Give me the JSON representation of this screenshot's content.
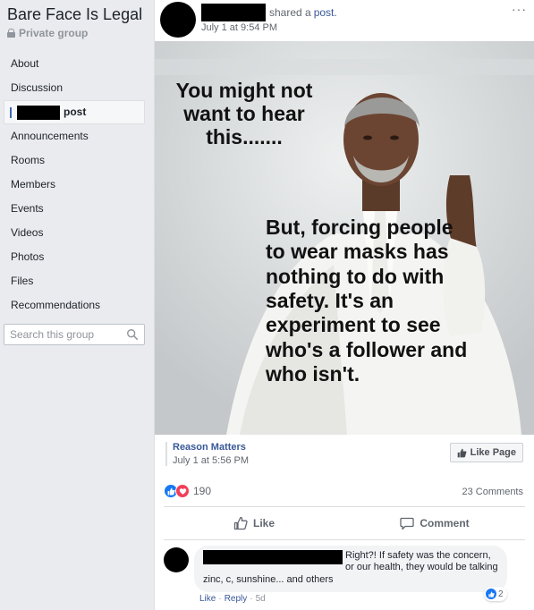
{
  "sidebar": {
    "group_name": "Bare Face Is Legal",
    "privacy": "Private group",
    "nav": [
      {
        "label": "About"
      },
      {
        "label": "Discussion"
      },
      {
        "label": "post",
        "active": true
      },
      {
        "label": "Announcements"
      },
      {
        "label": "Rooms"
      },
      {
        "label": "Members"
      },
      {
        "label": "Events"
      },
      {
        "label": "Videos"
      },
      {
        "label": "Photos"
      },
      {
        "label": "Files"
      },
      {
        "label": "Recommendations"
      }
    ],
    "search_placeholder": "Search this group"
  },
  "post": {
    "shared_text": "shared a",
    "shared_link": "post.",
    "time": "July 1 at 9:54 PM",
    "more": "···",
    "image_text_top": "You might not want to hear this.......",
    "image_text_bottom": "But, forcing people to wear masks has nothing to do with safety. It's an experiment to see who's a follower and who isn't.",
    "source_name": "Reason Matters",
    "source_time": "July 1 at 5:56 PM",
    "like_page_label": "Like Page",
    "reaction_count": "190",
    "comments_count": "23 Comments",
    "like_label": "Like",
    "comment_label": "Comment"
  },
  "comment": {
    "text": "Right?! If safety was the concern, or our health, they would be talking zinc, c, sunshine... and others",
    "reaction_count": "2",
    "like": "Like",
    "reply": "Reply",
    "time": "5d"
  },
  "colors": {
    "link": "#385898",
    "like_blue": "#1877f2",
    "love_red": "#f33e58",
    "background": "#e9ebee"
  }
}
